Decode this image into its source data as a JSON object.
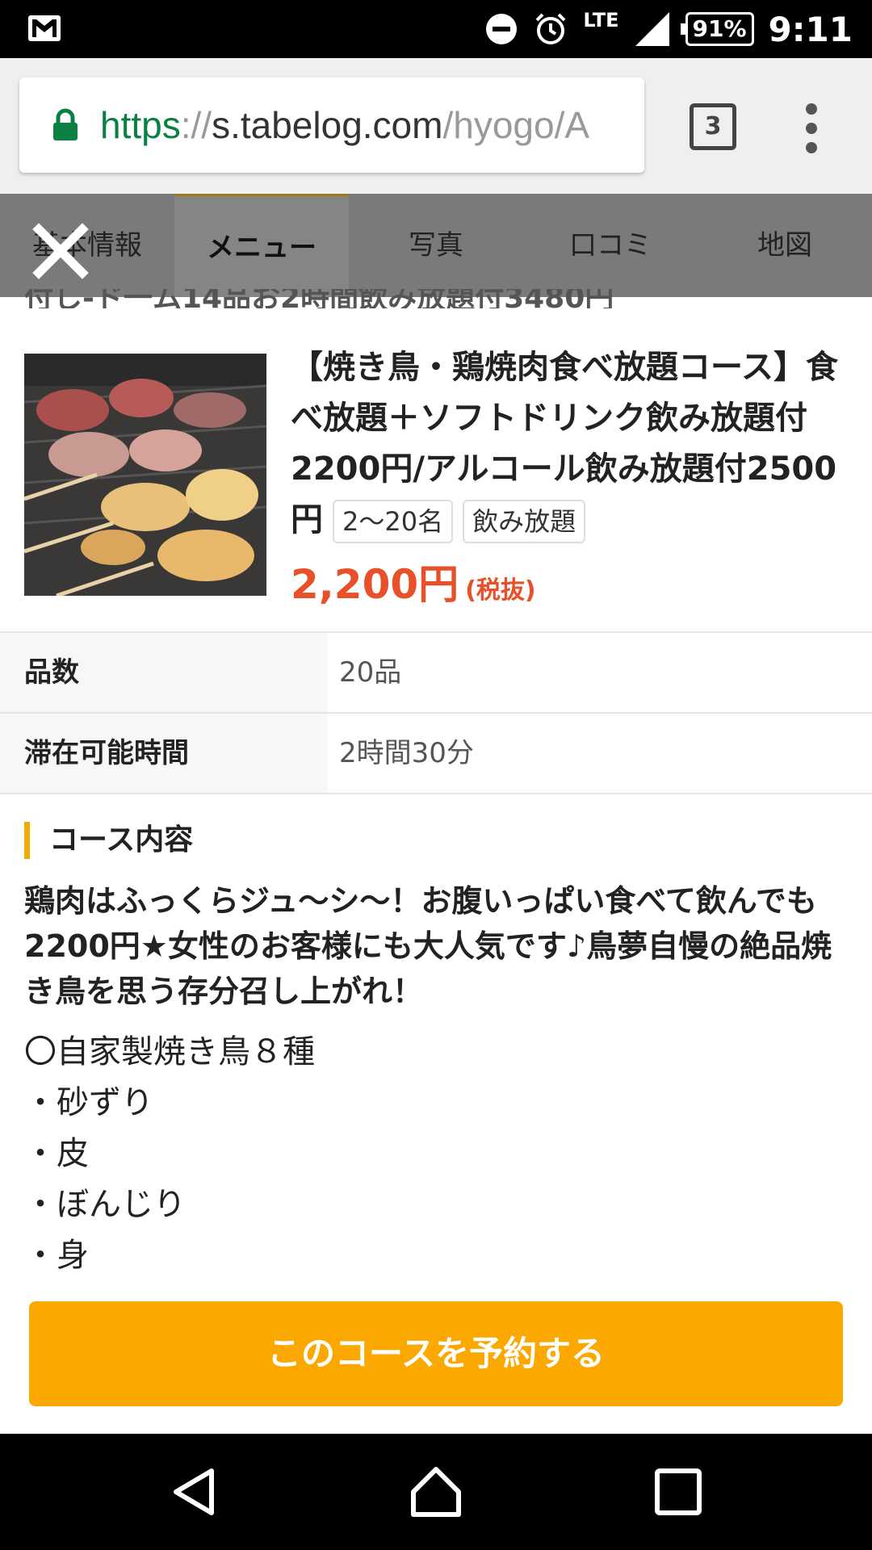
{
  "status_bar": {
    "network": "LTE",
    "battery": "91%",
    "time": "9:11",
    "icons": [
      "gmail-icon",
      "do-not-disturb-icon",
      "alarm-icon",
      "signal-icon",
      "battery-icon"
    ]
  },
  "browser": {
    "url_scheme": "https",
    "url_sep": "://",
    "url_host": "s.tabelog.com",
    "url_path": "/hyogo/A",
    "tab_count": "3"
  },
  "page_tabs": [
    {
      "label": "基本情報"
    },
    {
      "label": "メニュー"
    },
    {
      "label": "写真"
    },
    {
      "label": "口コミ"
    },
    {
      "label": "地図"
    }
  ],
  "behind_text": "付し-ド一ム14品お2時間飲み放題付3480円",
  "course": {
    "title": "【焼き鳥・鶏焼肉食べ放題コース】食べ放題＋ソフトドリンク飲み放題付2200円/アルコール飲み放題付2500円",
    "tags": [
      "2〜20名",
      "飲み放題"
    ],
    "price": "2,200円",
    "tax_note": "(税抜)",
    "info": [
      {
        "label": "品数",
        "value": "20品"
      },
      {
        "label": "滞在可能時間",
        "value": "2時間30分"
      }
    ],
    "contents_heading": "コース内容",
    "lead": "鶏肉はふっくらジュ〜シ〜！お腹いっぱい食べて飲んでも2200円★女性のお客様にも大人気です♪鳥夢自慢の絶品焼き鳥を思う存分召し上がれ！",
    "items": [
      "〇自家製焼き鳥８種",
      "・砂ずり",
      "・皮",
      "・ぼんじり",
      "・身"
    ],
    "reserve_label": "このコースを予約する"
  },
  "colors": {
    "accent_orange": "#fba800",
    "price_red": "#e8502a",
    "https_green": "#0b8043"
  }
}
